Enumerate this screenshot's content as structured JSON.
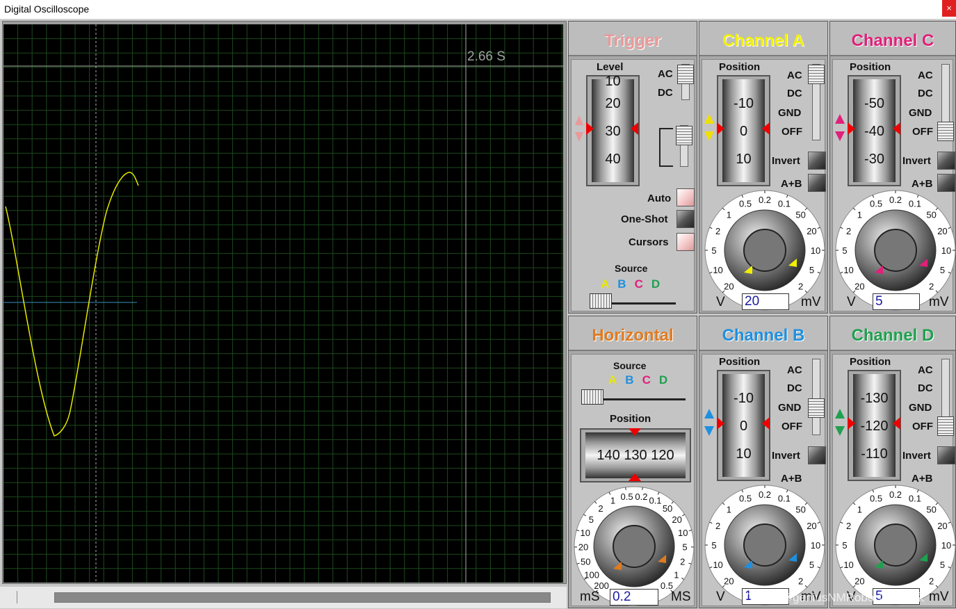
{
  "window": {
    "title": "Digital Oscilloscope",
    "close": "×"
  },
  "screen": {
    "cursor_time": "2.66 S"
  },
  "trigger": {
    "title": "Trigger",
    "level_label": "Level",
    "drum": [
      "10",
      "20",
      "30",
      "40"
    ],
    "ac": "AC",
    "dc": "DC",
    "auto": "Auto",
    "one_shot": "One-Shot",
    "cursors": "Cursors",
    "source_label": "Source",
    "sources": [
      "A",
      "B",
      "C",
      "D"
    ]
  },
  "horizontal": {
    "title": "Horizontal",
    "source_label": "Source",
    "sources": [
      "A",
      "B",
      "C",
      "D"
    ],
    "position_label": "Position",
    "drum": [
      "140",
      "130",
      "120"
    ],
    "scale": [
      "200",
      "100",
      "50",
      "20",
      "10",
      "5",
      "2",
      "1",
      "0.5",
      "0.2",
      "0.1",
      "50",
      "20",
      "10",
      "5",
      "2",
      "1",
      "0.5"
    ],
    "value": "0.2",
    "unit_left": "mS",
    "unit_right": "MS"
  },
  "channels": {
    "a": {
      "title": "Channel A",
      "color": "#f0f000",
      "position_label": "Position",
      "drum": [
        "-10",
        "0",
        "10"
      ],
      "ac": "AC",
      "dc": "DC",
      "gnd": "GND",
      "off": "OFF",
      "invert": "Invert",
      "aplusb": "A+B",
      "value": "20",
      "unit_left": "V",
      "unit_right": "mV"
    },
    "c": {
      "title": "Channel C",
      "color": "#e0207a",
      "position_label": "Position",
      "drum": [
        "-50",
        "-40",
        "-30"
      ],
      "ac": "AC",
      "dc": "DC",
      "gnd": "GND",
      "off": "OFF",
      "invert": "Invert",
      "aplusb": "A+B",
      "value": "5",
      "unit_left": "V",
      "unit_right": "mV"
    },
    "b": {
      "title": "Channel B",
      "color": "#1e90e0",
      "position_label": "Position",
      "drum": [
        "-10",
        "0",
        "10"
      ],
      "ac": "AC",
      "dc": "DC",
      "gnd": "GND",
      "off": "OFF",
      "invert": "Invert",
      "aplusb": "A+B",
      "value": "1",
      "unit_left": "V",
      "unit_right": "mV"
    },
    "d": {
      "title": "Channel D",
      "color": "#20a050",
      "position_label": "Position",
      "drum": [
        "-130",
        "-120",
        "-110"
      ],
      "ac": "AC",
      "dc": "DC",
      "gnd": "GND",
      "off": "OFF",
      "invert": "Invert",
      "aplusb": "A+B",
      "value": "5",
      "unit_left": "V",
      "unit_right": "mV"
    }
  },
  "volt_scale": [
    "20",
    "10",
    "5",
    "2",
    "1",
    "0.5",
    "0.2",
    "0.1",
    "50",
    "20",
    "10",
    "5",
    "2"
  ],
  "colors": {
    "screen_bg": "#000000",
    "grid": "#1c4a1c",
    "trace_a": "#e8e800",
    "trigger_line": "#3a8fbf",
    "horizontal": "#e07b20",
    "trigger": "#e89a9a"
  },
  "watermark": "CSDN @geniusNMRobot顶级专家"
}
